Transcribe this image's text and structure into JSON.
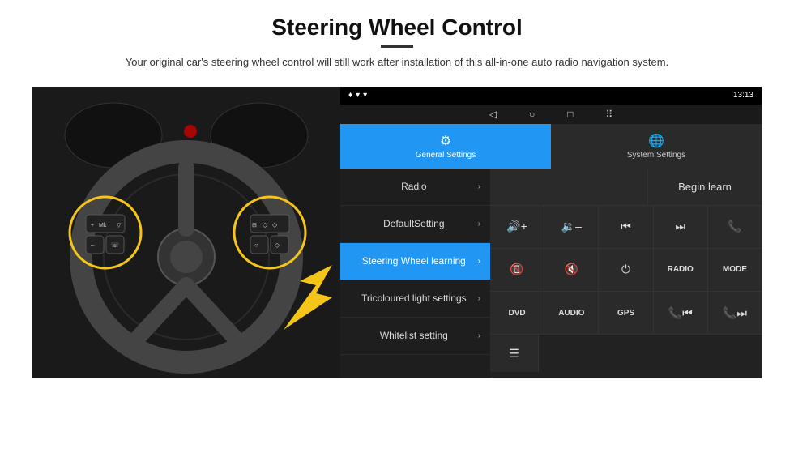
{
  "header": {
    "title": "Steering Wheel Control",
    "subtitle": "Your original car's steering wheel control will still work after installation of this all-in-one auto radio navigation system."
  },
  "status_bar": {
    "location_icon": "♦",
    "wifi_icon": "▾",
    "signal_icon": "▾",
    "time": "13:13"
  },
  "nav": {
    "back": "◁",
    "home": "○",
    "square": "□",
    "dots": "⠿"
  },
  "tabs": {
    "general": {
      "label": "General Settings",
      "icon": "⚙"
    },
    "system": {
      "label": "System Settings",
      "icon": "🌐"
    }
  },
  "menu_items": [
    {
      "label": "Radio",
      "active": false
    },
    {
      "label": "DefaultSetting",
      "active": false
    },
    {
      "label": "Steering Wheel learning",
      "active": true
    },
    {
      "label": "Tricoloured light settings",
      "active": false
    },
    {
      "label": "Whitelist setting",
      "active": false
    }
  ],
  "controls": {
    "begin_learn_label": "Begin learn",
    "row1": [
      {
        "label": "◀+",
        "type": "icon"
      },
      {
        "label": "◀–",
        "type": "icon"
      },
      {
        "label": "⏮",
        "type": "icon"
      },
      {
        "label": "⏭",
        "type": "icon"
      },
      {
        "label": "✆",
        "type": "icon"
      }
    ],
    "row2": [
      {
        "label": "☎",
        "type": "icon"
      },
      {
        "label": "🔇",
        "type": "icon"
      },
      {
        "label": "⏻",
        "type": "icon"
      },
      {
        "label": "RADIO",
        "type": "text"
      },
      {
        "label": "MODE",
        "type": "text"
      }
    ],
    "row3": [
      {
        "label": "DVD",
        "type": "text"
      },
      {
        "label": "AUDIO",
        "type": "text"
      },
      {
        "label": "GPS",
        "type": "text"
      },
      {
        "label": "✆⏮",
        "type": "icon"
      },
      {
        "label": "✆⏭",
        "type": "icon"
      }
    ],
    "row4": [
      {
        "label": "☰",
        "type": "icon"
      }
    ]
  }
}
